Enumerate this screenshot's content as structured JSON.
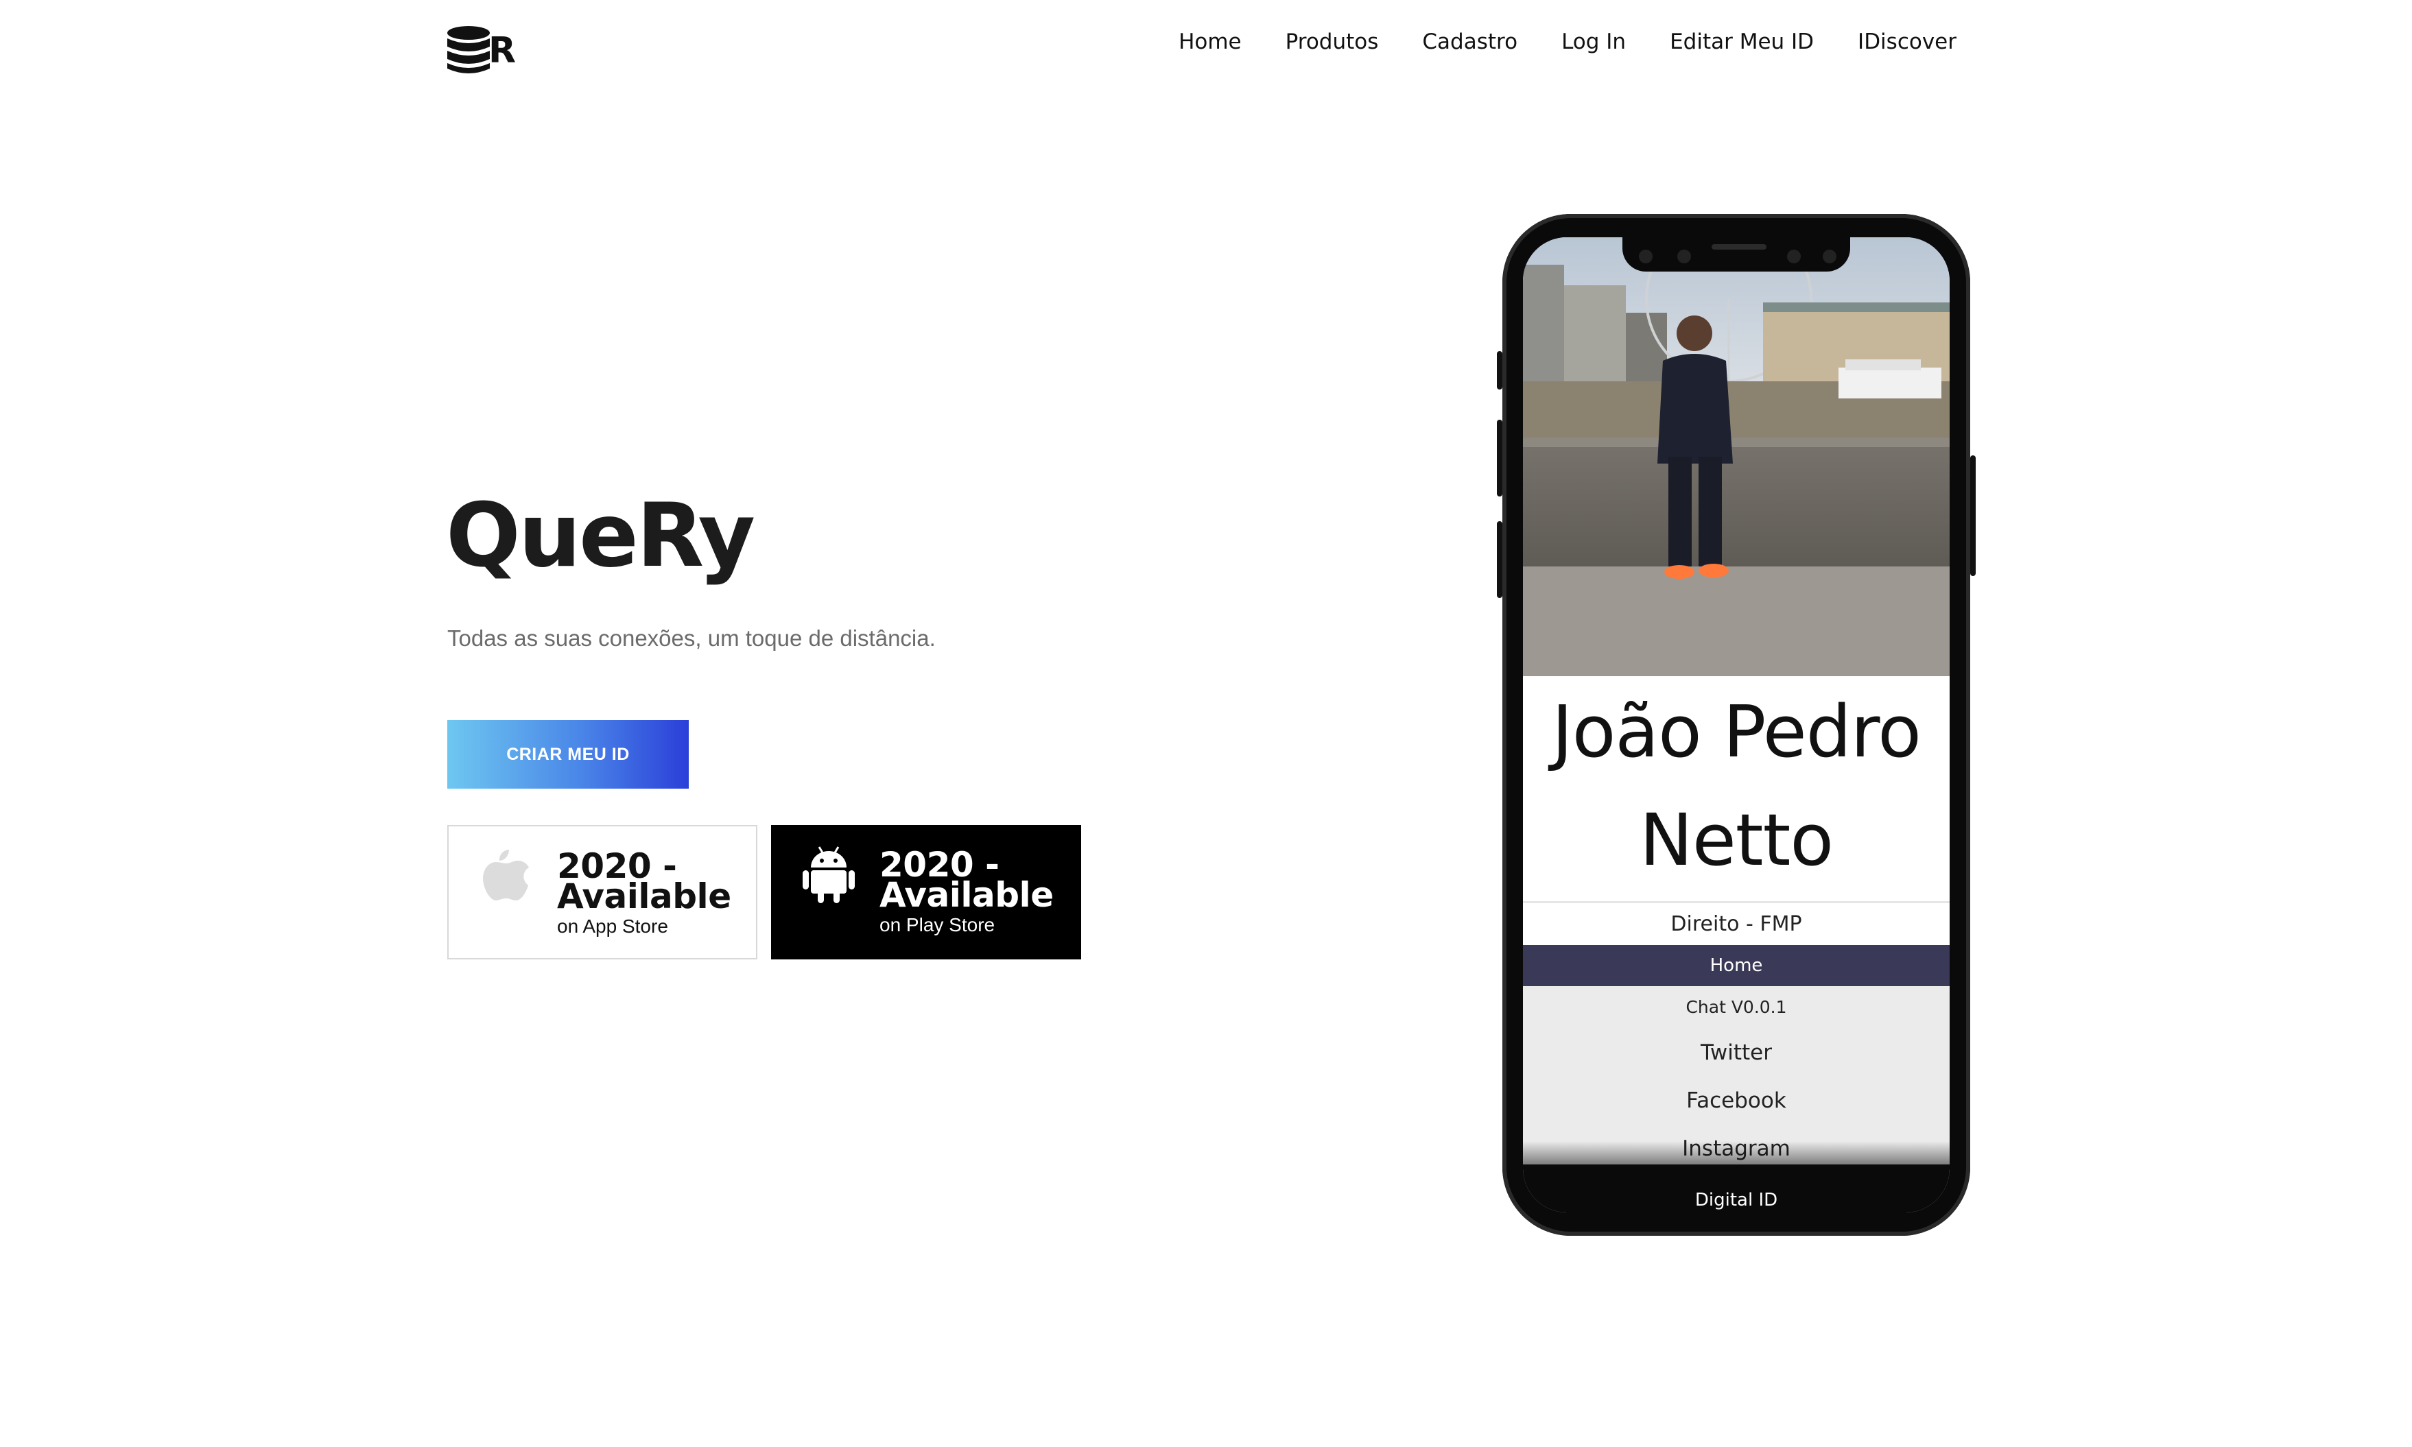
{
  "header": {
    "logo_letter": "R",
    "nav": [
      {
        "label": "Home"
      },
      {
        "label": "Produtos"
      },
      {
        "label": "Cadastro"
      },
      {
        "label": "Log In"
      },
      {
        "label": "Editar Meu ID"
      },
      {
        "label": "IDiscover"
      }
    ]
  },
  "hero": {
    "title": "QueRy",
    "tagline": "Todas as suas conexões, um toque de distância.",
    "cta_label": "CRIAR MEU ID",
    "cta_gradient": [
      "#6ec7f0",
      "#4a86e8",
      "#2b3fd9"
    ]
  },
  "badges": [
    {
      "icon": "apple-icon",
      "main": "2020 - Available",
      "sub": "on App Store"
    },
    {
      "icon": "android-icon",
      "main": "2020 - Available",
      "sub": "on Play Store"
    }
  ],
  "phone": {
    "profile_name_line1": "João Pedro",
    "profile_name_line2": "Netto",
    "subtitle": "Direito - FMP",
    "menu": [
      {
        "label": "Home",
        "active": true
      },
      {
        "label": "Chat V0.0.1"
      },
      {
        "label": "Twitter"
      },
      {
        "label": "Facebook"
      },
      {
        "label": "Instagram"
      }
    ],
    "bottom_bar": "Digital ID",
    "menu_active_color": "#3a3a58"
  }
}
